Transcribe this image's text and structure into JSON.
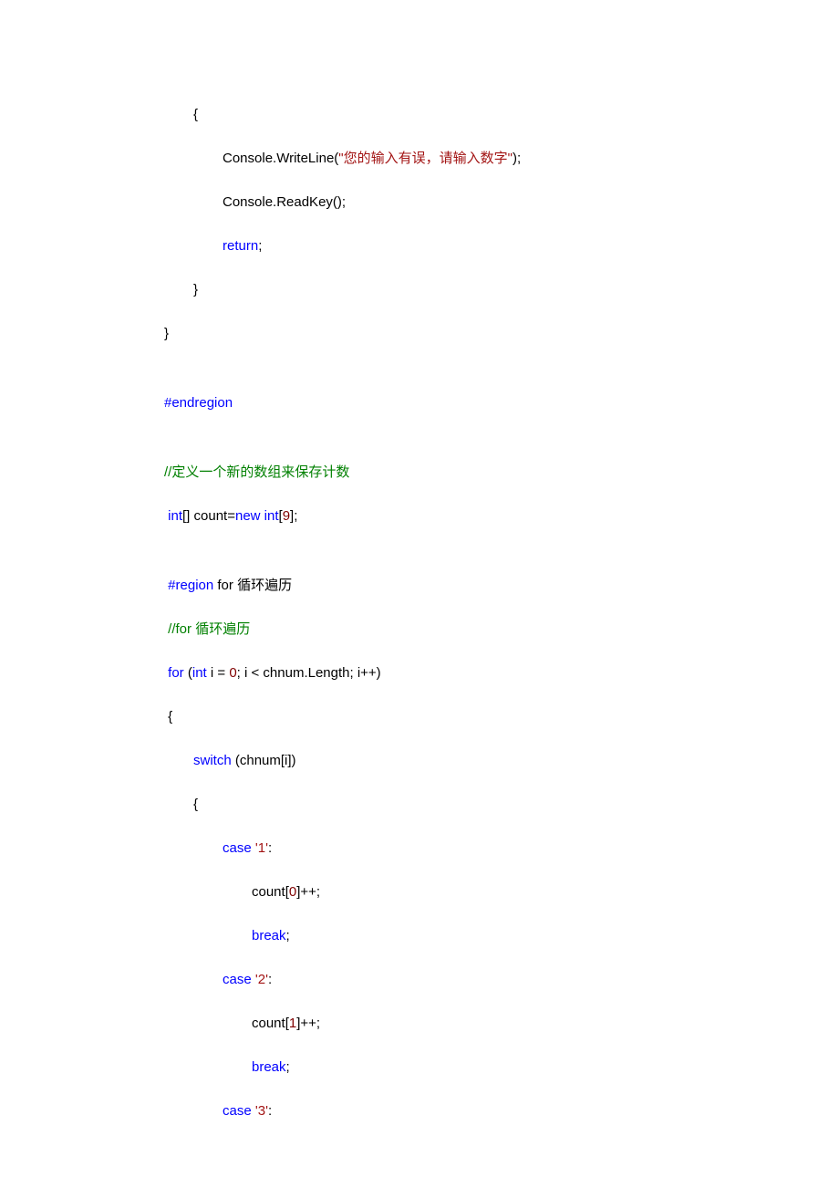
{
  "lines": {
    "l1": "{",
    "l2_a": "Console.WriteLine(",
    "l2_b": "\"",
    "l2_c": "您的输入有误，请输入数字",
    "l2_d": "\"",
    "l2_e": ");",
    "l3": "Console.ReadKey();",
    "l4_a": "return",
    "l4_b": ";",
    "l5": "}",
    "l6": "}",
    "l7": "#endregion",
    "l8_a": "//",
    "l8_b": "定义一个新的数组来保存计数",
    "l9_a": " int",
    "l9_b": "[] count=",
    "l9_c": "new int",
    "l9_d": "[",
    "l9_e": "9",
    "l9_f": "];",
    "l10_a": " #region",
    "l10_b": " for ",
    "l10_c": "循环遍历",
    "l11_a": " //for ",
    "l11_b": "循环遍历",
    "l12_a": " for",
    "l12_b": " (",
    "l12_c": "int",
    "l12_d": " i = ",
    "l12_e": "0",
    "l12_f": "; i < chnum.Length; i++)",
    "l13": " {",
    "l14_a": "switch",
    "l14_b": " (chnum[i])",
    "l15": "{",
    "l16_a": "case",
    "l16_b": " ",
    "l16_c": "'1'",
    "l16_d": ":",
    "l17_a": "count[",
    "l17_b": "0",
    "l17_c": "]++;",
    "l18_a": "break",
    "l18_b": ";",
    "l19_a": "case",
    "l19_b": " ",
    "l19_c": "'2'",
    "l19_d": ":",
    "l20_a": "count[",
    "l20_b": "1",
    "l20_c": "]++;",
    "l21_a": "break",
    "l21_b": ";",
    "l22_a": "case",
    "l22_b": " ",
    "l22_c": "'3'",
    "l22_d": ":"
  }
}
